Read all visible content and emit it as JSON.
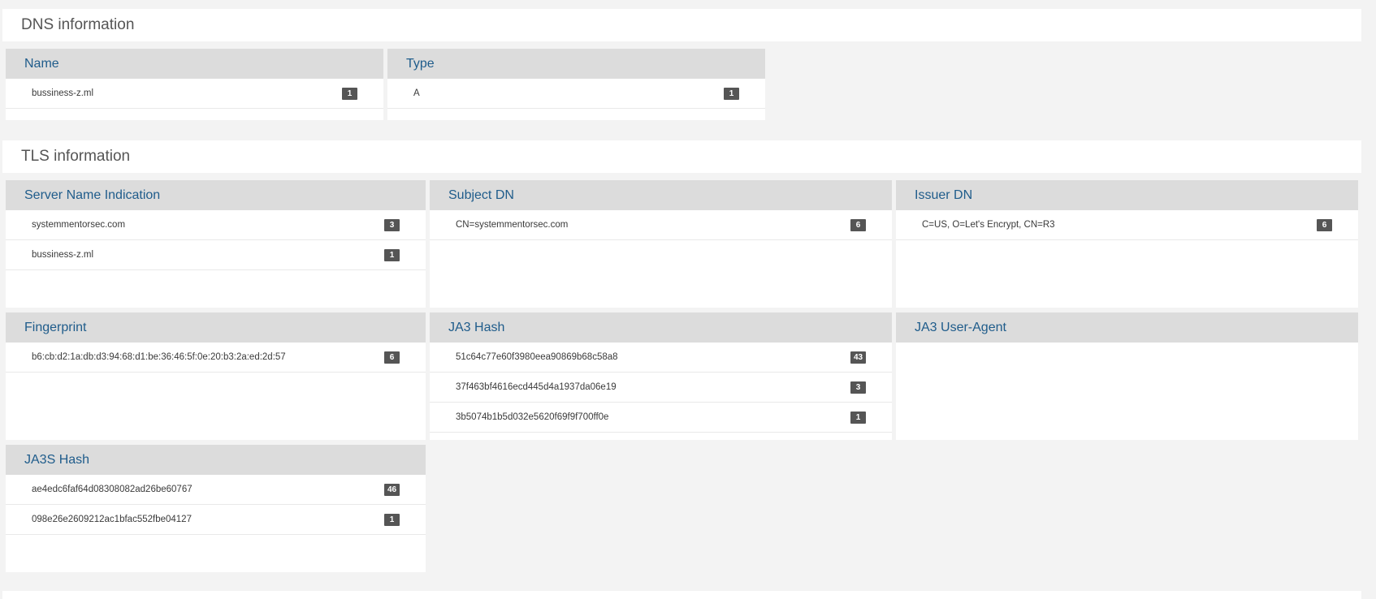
{
  "dns": {
    "title": "DNS information",
    "name": {
      "title": "Name",
      "rows": [
        {
          "value": "bussiness-z.ml",
          "count": "1"
        }
      ]
    },
    "type": {
      "title": "Type",
      "rows": [
        {
          "value": "A",
          "count": "1"
        }
      ]
    }
  },
  "tls": {
    "title": "TLS information",
    "sni": {
      "title": "Server Name Indication",
      "rows": [
        {
          "value": "systemmentorsec.com",
          "count": "3"
        },
        {
          "value": "bussiness-z.ml",
          "count": "1"
        }
      ]
    },
    "subject": {
      "title": "Subject DN",
      "rows": [
        {
          "value": "CN=systemmentorsec.com",
          "count": "6"
        }
      ]
    },
    "issuer": {
      "title": "Issuer DN",
      "rows": [
        {
          "value": "C=US, O=Let's Encrypt, CN=R3",
          "count": "6"
        }
      ]
    },
    "fingerprint": {
      "title": "Fingerprint",
      "rows": [
        {
          "value": "b6:cb:d2:1a:db:d3:94:68:d1:be:36:46:5f:0e:20:b3:2a:ed:2d:57",
          "count": "6"
        }
      ]
    },
    "ja3": {
      "title": "JA3 Hash",
      "rows": [
        {
          "value": "51c64c77e60f3980eea90869b68c58a8",
          "count": "43"
        },
        {
          "value": "37f463bf4616ecd445d4a1937da06e19",
          "count": "3"
        },
        {
          "value": "3b5074b1b5d032e5620f69f9f700ff0e",
          "count": "1"
        }
      ]
    },
    "ja3ua": {
      "title": "JA3 User-Agent",
      "rows": []
    },
    "ja3s": {
      "title": "JA3S Hash",
      "rows": [
        {
          "value": "ae4edc6faf64d08308082ad26be60767",
          "count": "46"
        },
        {
          "value": "098e26e2609212ac1bfac552fbe04127",
          "count": "1"
        }
      ]
    }
  }
}
